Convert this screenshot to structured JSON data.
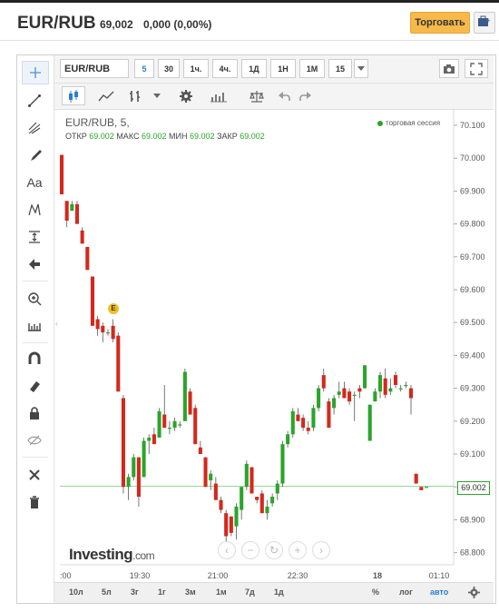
{
  "header": {
    "symbol": "EUR/RUB",
    "price": "69,002",
    "change": "0,000 (0,00%)",
    "trade_button": "Торговать"
  },
  "toolbar": {
    "symbol_input": "EUR/RUB",
    "timeframes": [
      "5",
      "30",
      "1ч.",
      "4ч.",
      "1Д",
      "1Н",
      "1М",
      "15"
    ],
    "active_timeframe": "5",
    "dropdown_icon": "chevron-down-icon",
    "right_icons": [
      "camera-icon",
      "fullscreen-icon"
    ],
    "row2_icons": [
      "candlestick-icon",
      "line-chart-icon",
      "indicators-icon",
      "gear-icon",
      "compare-icon",
      "scale-icon",
      "undo-icon",
      "redo-icon"
    ]
  },
  "left_tools": [
    "crosshair-icon",
    "trend-line-icon",
    "fork-icon",
    "brush-icon",
    "text-icon",
    "pattern-icon",
    "measure-icon",
    "arrow-left-icon",
    "zoom-icon",
    "ruler-icon",
    "magnet-icon",
    "eraser-icon",
    "lock-icon",
    "eye-off-icon",
    "tools-icon",
    "trash-icon"
  ],
  "legend": {
    "title": "EUR/RUB, 5,",
    "open_label": "ОТКР",
    "open": "69.002",
    "high_label": "МАКС",
    "high": "69.002",
    "low_label": "МИН",
    "low": "69.002",
    "close_label": "ЗАКР",
    "close": "69.002",
    "session": "торговая сессия"
  },
  "event_badge": "E",
  "logo": {
    "name": "Investing",
    "suffix": ".com"
  },
  "nav_controls": [
    "‹",
    "−",
    "↻",
    "+",
    "›"
  ],
  "price_tag": "69.002",
  "ranges": [
    "10л",
    "5л",
    "3г",
    "1г",
    "3м",
    "1м",
    "7д",
    "1д"
  ],
  "bottom_right": [
    "%",
    "лог",
    "авто"
  ],
  "bottom_gear": "gear-icon",
  "colors": {
    "up": "#2aa52a",
    "down": "#d4281c",
    "accent": "#2a7fd4",
    "trade": "#f6b94a"
  },
  "chart_data": {
    "type": "candlestick",
    "x_tick_labels": [
      ":00",
      "19:30",
      "21:00",
      "22:30",
      "18",
      "01:10"
    ],
    "y_tick_labels": [
      "70.100",
      "70.000",
      "69.900",
      "69.800",
      "69.700",
      "69.600",
      "69.500",
      "69.400",
      "69.300",
      "69.200",
      "69.100",
      "69.000",
      "68.900",
      "68.800"
    ],
    "ylim": [
      68.77,
      70.12
    ],
    "last_price": 69.002,
    "candles": [
      [
        70.01,
        70.01,
        69.89,
        69.89
      ],
      [
        69.87,
        69.87,
        69.79,
        69.81
      ],
      [
        69.84,
        69.87,
        69.84,
        69.86
      ],
      [
        69.86,
        69.87,
        69.8,
        69.8
      ],
      [
        69.78,
        69.79,
        69.74,
        69.74
      ],
      [
        69.73,
        69.73,
        69.66,
        69.66
      ],
      [
        69.64,
        69.64,
        69.49,
        69.49
      ],
      [
        69.51,
        69.52,
        69.46,
        69.48
      ],
      [
        69.49,
        69.5,
        69.44,
        69.47
      ],
      [
        69.47,
        69.48,
        69.46,
        69.47
      ],
      [
        69.49,
        69.51,
        69.44,
        69.45
      ],
      [
        69.46,
        69.47,
        69.29,
        69.29
      ],
      [
        69.27,
        69.28,
        68.98,
        69.0
      ],
      [
        69.0,
        69.04,
        68.96,
        69.03
      ],
      [
        69.03,
        69.1,
        69.02,
        69.09
      ],
      [
        69.09,
        69.09,
        68.94,
        68.97
      ],
      [
        69.03,
        69.15,
        69.03,
        69.14
      ],
      [
        69.14,
        69.16,
        69.1,
        69.15
      ],
      [
        69.16,
        69.18,
        69.13,
        69.13
      ],
      [
        69.15,
        69.24,
        69.15,
        69.23
      ],
      [
        69.22,
        69.31,
        69.18,
        69.18
      ],
      [
        69.18,
        69.2,
        69.16,
        69.18
      ],
      [
        69.18,
        69.21,
        69.17,
        69.2
      ],
      [
        69.19,
        69.2,
        69.18,
        69.19
      ],
      [
        69.2,
        69.36,
        69.2,
        69.35
      ],
      [
        69.29,
        69.3,
        69.22,
        69.22
      ],
      [
        69.24,
        69.25,
        69.13,
        69.13
      ],
      [
        69.12,
        69.14,
        69.1,
        69.1
      ],
      [
        69.09,
        69.09,
        69.0,
        69.0
      ],
      [
        69.02,
        69.05,
        68.99,
        69.04
      ],
      [
        69.01,
        69.03,
        68.96,
        68.96
      ],
      [
        68.96,
        68.97,
        68.92,
        68.93
      ],
      [
        68.92,
        68.93,
        68.83,
        68.85
      ],
      [
        68.91,
        68.91,
        68.85,
        68.86
      ],
      [
        68.88,
        68.95,
        68.84,
        68.94
      ],
      [
        68.93,
        69.0,
        68.9,
        69.0
      ],
      [
        69.0,
        69.08,
        68.99,
        69.07
      ],
      [
        69.06,
        69.06,
        68.98,
        68.98
      ],
      [
        68.97,
        68.97,
        68.95,
        68.96
      ],
      [
        68.98,
        68.99,
        68.92,
        68.92
      ],
      [
        68.92,
        68.96,
        68.9,
        68.94
      ],
      [
        68.95,
        68.98,
        68.94,
        68.97
      ],
      [
        68.98,
        69.02,
        68.96,
        69.01
      ],
      [
        69.01,
        69.14,
        69.0,
        69.13
      ],
      [
        69.13,
        69.17,
        69.12,
        69.16
      ],
      [
        69.16,
        69.24,
        69.15,
        69.23
      ],
      [
        69.22,
        69.24,
        69.2,
        69.2
      ],
      [
        69.21,
        69.22,
        69.17,
        69.18
      ],
      [
        69.18,
        69.2,
        69.16,
        69.17
      ],
      [
        69.18,
        69.25,
        69.17,
        69.24
      ],
      [
        69.24,
        69.31,
        69.23,
        69.3
      ],
      [
        69.34,
        69.36,
        69.29,
        69.3
      ],
      [
        69.26,
        69.27,
        69.18,
        69.18
      ],
      [
        69.24,
        69.28,
        69.22,
        69.27
      ],
      [
        69.28,
        69.32,
        69.27,
        69.29
      ],
      [
        69.3,
        69.32,
        69.27,
        69.27
      ],
      [
        69.29,
        69.3,
        69.25,
        69.26
      ],
      [
        69.28,
        69.29,
        69.2,
        69.28
      ],
      [
        69.3,
        69.31,
        69.27,
        69.29
      ],
      [
        69.3,
        69.37,
        69.3,
        69.37
      ],
      [
        69.14,
        69.25,
        69.14,
        69.25
      ],
      [
        69.26,
        69.3,
        69.26,
        69.29
      ],
      [
        69.29,
        69.35,
        69.27,
        69.34
      ],
      [
        69.33,
        69.36,
        69.27,
        69.28
      ],
      [
        69.29,
        69.33,
        69.28,
        69.3
      ],
      [
        69.34,
        69.35,
        69.3,
        69.31
      ],
      [
        69.3,
        69.31,
        69.29,
        69.3
      ],
      [
        69.31,
        69.32,
        69.3,
        69.31
      ],
      [
        69.3,
        69.31,
        69.22,
        69.27
      ],
      [
        69.04,
        69.04,
        69.01,
        69.01
      ],
      [
        69.0,
        69.0,
        68.99,
        68.99
      ],
      [
        69.0,
        69.0,
        69.0,
        69.0
      ]
    ]
  }
}
